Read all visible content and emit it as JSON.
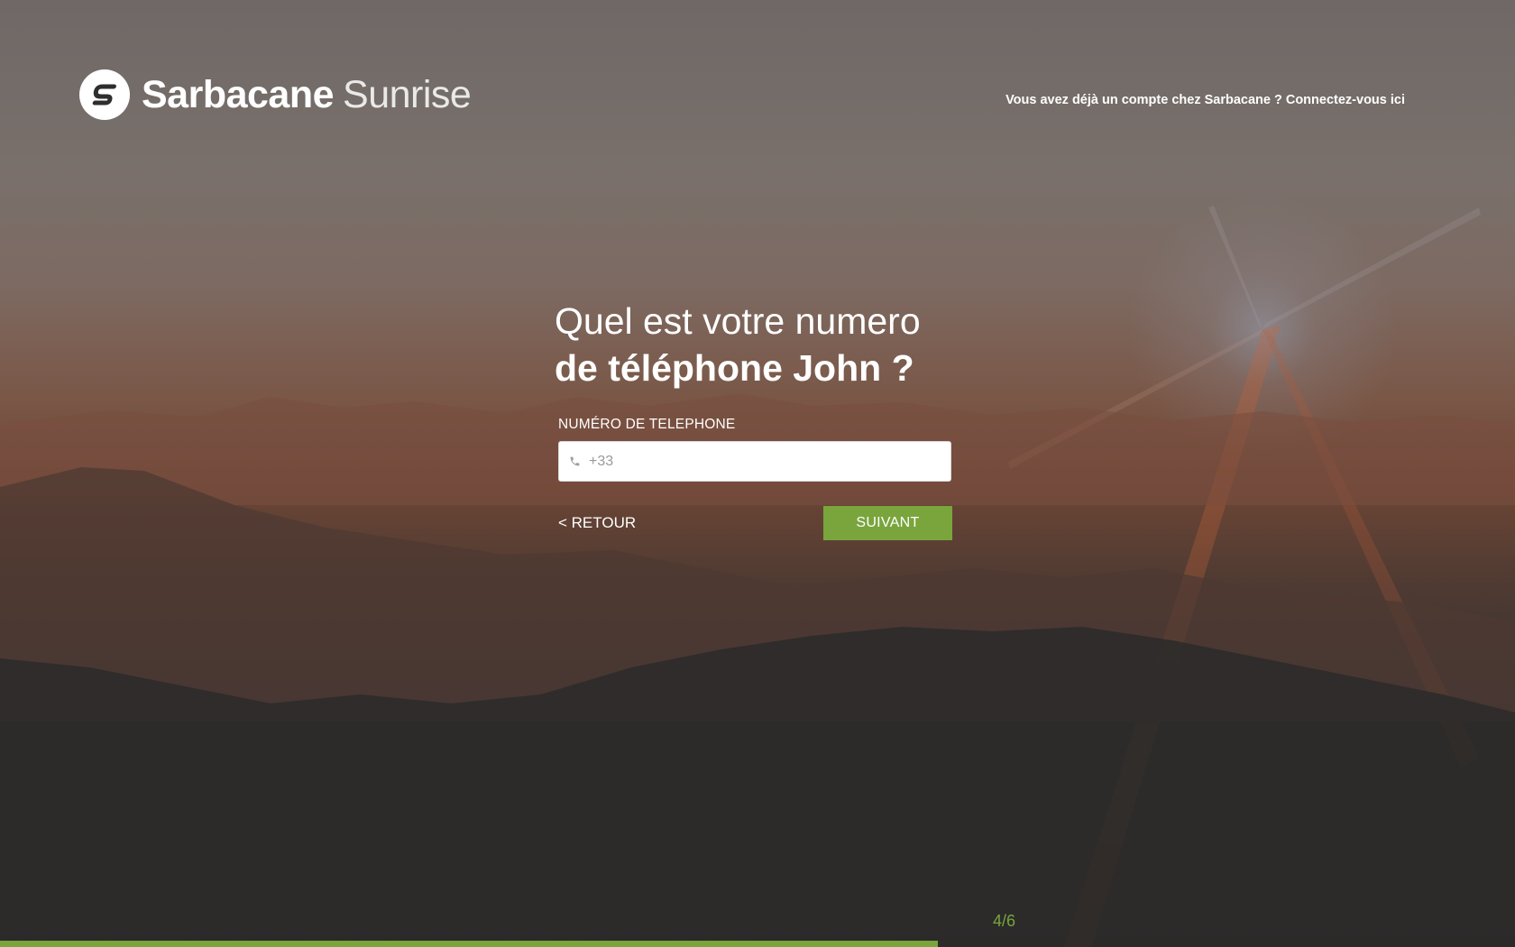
{
  "brand": {
    "name": "Sarbacane",
    "product": "Sunrise"
  },
  "header": {
    "login_link": "Vous avez déjà un compte chez Sarbacane ? Connectez-vous ici"
  },
  "question": {
    "line1": "Quel est votre numero",
    "line2": "de téléphone John ?"
  },
  "form": {
    "phone_label": "NUMÉRO DE TELEPHONE",
    "phone_value": "",
    "phone_placeholder": "+33",
    "phone_icon": "phone-icon",
    "back_label": "< RETOUR",
    "next_label": "SUIVANT"
  },
  "progress": {
    "step_text": "4/6",
    "current": 4,
    "total": 6,
    "fraction": 0.667
  },
  "colors": {
    "accent": "#79a53c",
    "text": "#ffffff"
  }
}
